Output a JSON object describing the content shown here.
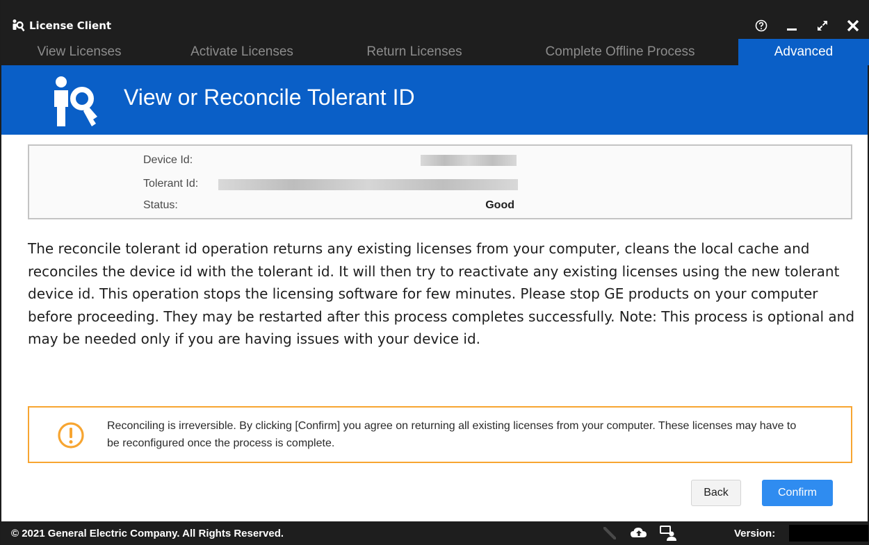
{
  "window": {
    "title": "License Client",
    "controls": [
      "help-icon",
      "minimize-icon",
      "maximize-icon",
      "close-icon"
    ]
  },
  "tabs": [
    {
      "label": "View Licenses",
      "active": false
    },
    {
      "label": "Activate Licenses",
      "active": false
    },
    {
      "label": "Return Licenses",
      "active": false
    },
    {
      "label": "Complete Offline Process",
      "active": false
    },
    {
      "label": "Advanced",
      "active": true
    }
  ],
  "banner": {
    "icon": "license-key-user-icon",
    "heading": "View or Reconcile Tolerant ID"
  },
  "info": {
    "device_id_label": "Device Id:",
    "tolerant_id_label": "Tolerant Id:",
    "status_label": "Status:",
    "status_value": "Good"
  },
  "description": "The reconcile tolerant id operation returns any existing licenses from your computer, cleans the local cache and reconciles the device id with the tolerant id. It will then try to reactivate any existing licenses using the new tolerant device id. This operation stops the licensing software for few minutes. Please stop GE products on your computer before proceeding. They may be restarted after this process completes successfully. Note: This process is optional and may be needed only if you are having issues with your device id.",
  "warning": {
    "icon": "exclamation-circle-icon",
    "text": "Reconciling is irreversible. By clicking [Confirm] you agree on returning all existing licenses from your computer. These licenses may have to be reconfigured once the process is complete."
  },
  "buttons": {
    "back": "Back",
    "confirm": "Confirm"
  },
  "footer": {
    "copyright": "© 2021 General Electric Company.  All Rights Reserved.",
    "icons": [
      "pen-icon",
      "cloud-sync-icon",
      "user-chat-icon"
    ],
    "version_label": "Version:"
  },
  "colors": {
    "accent_blue": "#0a5fc7",
    "confirm_blue": "#2f8cf0",
    "dark_bar": "#1e1e1e",
    "warning_orange": "#f7a531"
  }
}
